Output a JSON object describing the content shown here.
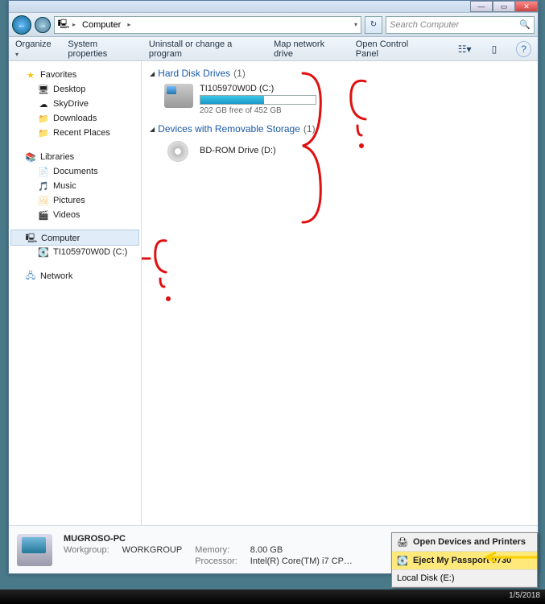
{
  "window_controls": {
    "min": "—",
    "max": "▭",
    "close": "✕"
  },
  "nav": {
    "back": "←",
    "fwd": "→",
    "crumb_icon": "🖳",
    "crumb": "Computer",
    "tri": "▸",
    "refresh": "↻",
    "search_placeholder": "Search Computer"
  },
  "toolbar": {
    "organize": "Organize",
    "sysprops": "System properties",
    "uninstall": "Uninstall or change a program",
    "mapdrive": "Map network drive",
    "controlpanel": "Open Control Panel",
    "help": "?"
  },
  "sidebar": {
    "favorites": "Favorites",
    "fav_items": [
      "Desktop",
      "SkyDrive",
      "Downloads",
      "Recent Places"
    ],
    "libraries": "Libraries",
    "lib_items": [
      "Documents",
      "Music",
      "Pictures",
      "Videos"
    ],
    "computer": "Computer",
    "computer_items": [
      "TI105970W0D (C:)"
    ],
    "network": "Network"
  },
  "main": {
    "hdd_header": "Hard Disk Drives",
    "hdd_count": "(1)",
    "hdd_name": "TI105970W0D (C:)",
    "hdd_free": "202 GB free of 452 GB",
    "rem_header": "Devices with Removable Storage",
    "rem_count": "(1)",
    "bd_name": "BD-ROM Drive (D:)"
  },
  "status": {
    "pcname": "MUGROSO-PC",
    "wg_lbl": "Workgroup:",
    "wg_val": "WORKGROUP",
    "mem_lbl": "Memory:",
    "mem_val": "8.00 GB",
    "proc_lbl": "Processor:",
    "proc_val": "Intel(R) Core(TM) i7 CP…"
  },
  "eject": {
    "open": "Open Devices and Printers",
    "eject": "Eject My Passport 0730",
    "local": "Local Disk (E:)"
  },
  "taskbar": {
    "time": "1/5/2018"
  }
}
